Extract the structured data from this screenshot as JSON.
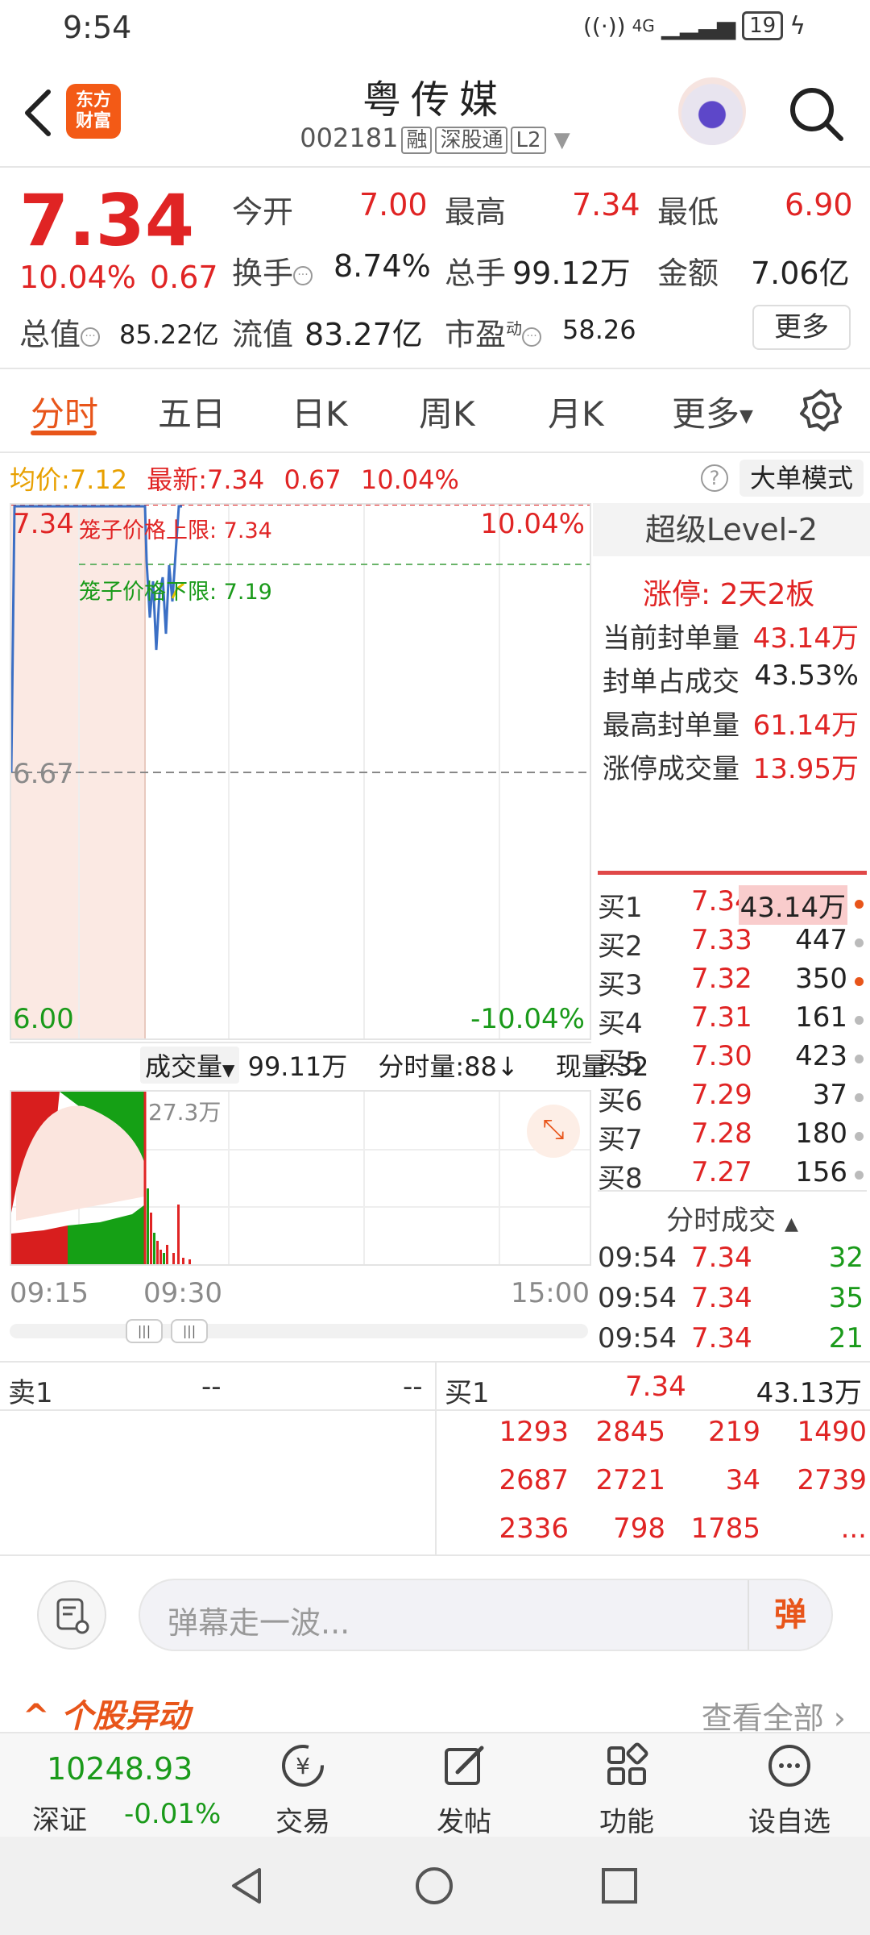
{
  "status": {
    "time": "9:54",
    "network": "4G",
    "battery": "19"
  },
  "header": {
    "logo_line1": "东方",
    "logo_line2": "财富",
    "title": "粤传媒",
    "code": "002181",
    "tags": [
      "融",
      "深股通",
      "L2"
    ]
  },
  "quote": {
    "price": "7.34",
    "pct": "10.04%",
    "change": "0.67",
    "open_label": "今开",
    "open": "7.00",
    "high_label": "最高",
    "high": "7.34",
    "low_label": "最低",
    "low": "6.90",
    "turnover_label": "换手",
    "turnover": "8.74%",
    "volume_label": "总手",
    "volume": "99.12万",
    "amount_label": "金额",
    "amount": "7.06亿",
    "mktcap_label": "总值",
    "mktcap": "85.22亿",
    "float_label": "流值",
    "float": "83.27亿",
    "pe_label": "市盈",
    "pe_sup": "动",
    "pe": "58.26",
    "more": "更多"
  },
  "tabs": [
    "分时",
    "五日",
    "日K",
    "周K",
    "月K",
    "更多"
  ],
  "info": {
    "avg_label": "均价:",
    "avg": "7.12",
    "latest_label": "最新:",
    "latest": "7.34",
    "chg": "0.67",
    "pct": "10.04%",
    "big_mode": "大单模式",
    "help": "?"
  },
  "chart": {
    "top_price": "7.34",
    "top_pct": "10.04%",
    "mid_price": "6.67",
    "bot_price": "6.00",
    "bot_pct": "-10.04%",
    "upper_limit": "笼子价格上限: 7.34",
    "lower_limit": "笼子价格下限: 7.19"
  },
  "volume": {
    "label": "成交量",
    "total": "99.11万",
    "tick_label": "分时量:88↓",
    "now_label": "现量:32",
    "max": "27.3万",
    "t1": "09:15",
    "t2": "09:30",
    "t3": "15:00"
  },
  "level2": {
    "title": "超级Level-2",
    "limit_info": "涨停: 2天2板",
    "rows": [
      {
        "label": "当前封单量",
        "value": "43.14万"
      },
      {
        "label": "封单占成交",
        "value": "43.53%"
      },
      {
        "label": "最高封单量",
        "value": "61.14万"
      },
      {
        "label": "涨停成交量",
        "value": "13.95万"
      }
    ],
    "bids": [
      {
        "label": "买1",
        "price": "7.34",
        "qty": "43.14万"
      },
      {
        "label": "买2",
        "price": "7.33",
        "qty": "447"
      },
      {
        "label": "买3",
        "price": "7.32",
        "qty": "350"
      },
      {
        "label": "买4",
        "price": "7.31",
        "qty": "161"
      },
      {
        "label": "买5",
        "price": "7.30",
        "qty": "423"
      },
      {
        "label": "买6",
        "price": "7.29",
        "qty": "37"
      },
      {
        "label": "买7",
        "price": "7.28",
        "qty": "180"
      },
      {
        "label": "买8",
        "price": "7.27",
        "qty": "156"
      }
    ],
    "ticks_title": "分时成交",
    "ticks": [
      {
        "time": "09:54",
        "price": "7.34",
        "qty": "32"
      },
      {
        "time": "09:54",
        "price": "7.34",
        "qty": "35"
      },
      {
        "time": "09:54",
        "price": "7.34",
        "qty": "21"
      }
    ]
  },
  "board": {
    "sell_label": "卖1",
    "sell_price": "--",
    "sell_qty": "--",
    "buy_label": "买1",
    "buy_price": "7.34",
    "buy_qty": "43.13万",
    "grid": [
      [
        "1293",
        "2845",
        "219",
        "1490"
      ],
      [
        "2687",
        "2721",
        "34",
        "2739"
      ],
      [
        "2336",
        "798",
        "1785",
        "..."
      ]
    ]
  },
  "danmu": {
    "placeholder": "弹幕走一波...",
    "button": "弹"
  },
  "anomaly": {
    "title": "个股异动",
    "see_all": "查看全部"
  },
  "bottom": {
    "index_value": "10248.93",
    "index_name": "深证",
    "index_chg": "-0.01%",
    "items": [
      "交易",
      "发帖",
      "功能",
      "设自选"
    ]
  },
  "colors": {
    "up": "#e02424",
    "down": "#1a9a1a",
    "accent": "#e8551a"
  }
}
